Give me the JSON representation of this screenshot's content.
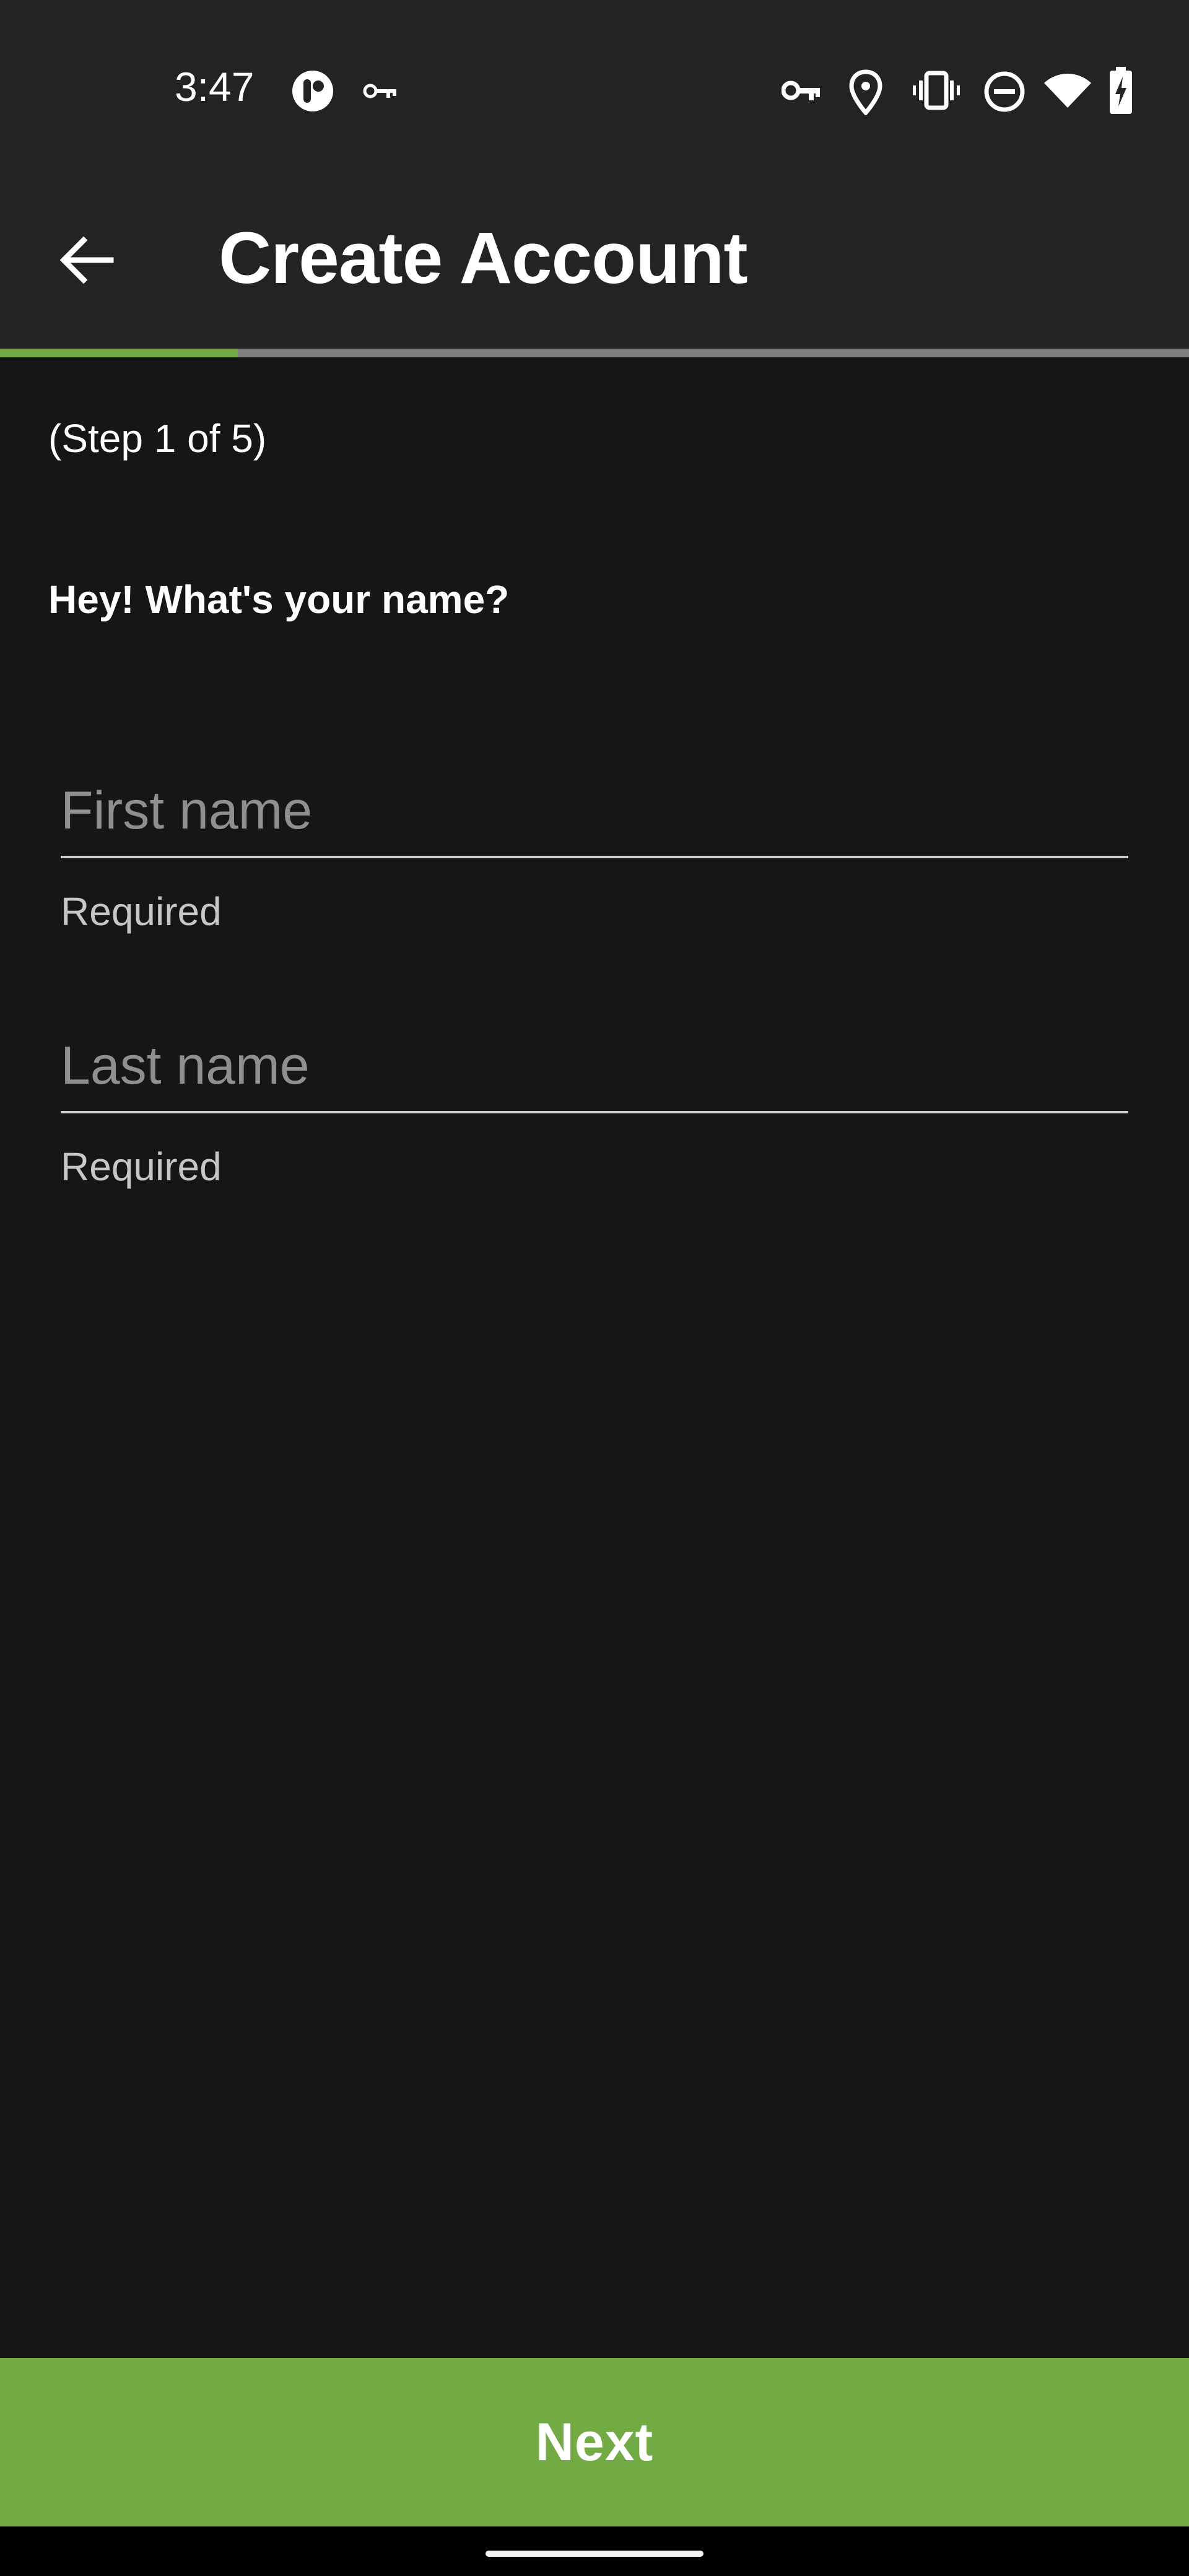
{
  "status_bar": {
    "time": "3:47",
    "icons": [
      "app-notification-icon",
      "vpn-key-icon",
      "key-icon",
      "location-icon",
      "vibrate-icon",
      "do-not-disturb-icon",
      "wifi-icon",
      "battery-charging-icon"
    ]
  },
  "app_bar": {
    "title": "Create Account",
    "back_icon": "back-arrow-icon"
  },
  "progress": {
    "current_step": 1,
    "total_steps": 5,
    "fraction": 0.2
  },
  "form": {
    "step_label": "(Step 1 of 5)",
    "question": "Hey! What's your name?",
    "first_name": {
      "value": "",
      "placeholder": "First name",
      "helper": "Required"
    },
    "last_name": {
      "value": "",
      "placeholder": "Last name",
      "helper": "Required"
    }
  },
  "actions": {
    "next_label": "Next"
  },
  "colors": {
    "accent": "#72aa44",
    "background": "#161616",
    "app_bar": "#232323",
    "progress_track": "#7e7e7e"
  }
}
